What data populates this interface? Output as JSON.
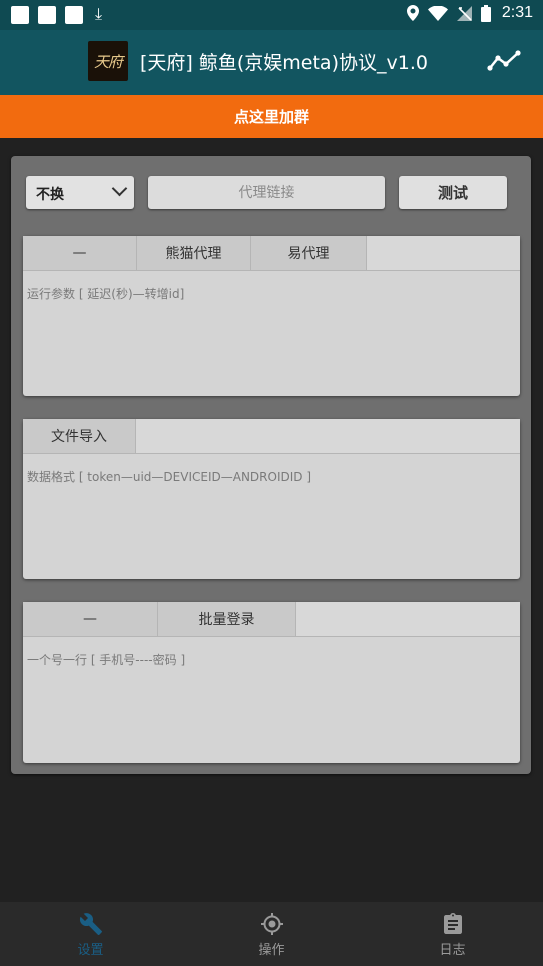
{
  "status_bar": {
    "time": "2:31",
    "icons": [
      "app-square-icon",
      "app-square-icon",
      "app-square-icon",
      "download-icon",
      "location-icon",
      "wifi-icon",
      "no-signal-icon",
      "battery-icon"
    ]
  },
  "app_bar": {
    "logo_text": "天府",
    "title": "[天府] 鲸鱼(京娱meta)协议_v1.0",
    "action_icon": "trend-icon"
  },
  "banner": {
    "text": "点这里加群"
  },
  "controls": {
    "mode_select": {
      "value": "不换"
    },
    "proxy_input": {
      "placeholder": "代理链接",
      "value": ""
    },
    "test_button": "测试"
  },
  "proxy_card": {
    "tabs": [
      "—",
      "熊猫代理",
      "易代理"
    ],
    "textarea_placeholder": "运行参数 [ 延迟(秒)—转增id]"
  },
  "import_card": {
    "tabs": [
      "文件导入"
    ],
    "textarea_placeholder": "数据格式 [ token—uid—DEVICEID—ANDROIDID ]"
  },
  "login_card": {
    "tabs": [
      "—",
      "批量登录"
    ],
    "textarea_placeholder": "一个号一行 [ 手机号----密码 ]"
  },
  "bottom_nav": [
    {
      "label": "设置",
      "icon": "wrench-icon",
      "active": true
    },
    {
      "label": "操作",
      "icon": "target-icon",
      "active": false
    },
    {
      "label": "日志",
      "icon": "clipboard-icon",
      "active": false
    }
  ],
  "colors": {
    "app_bar": "#125560",
    "status_bar": "#0f4a52",
    "banner": "#f26b0f",
    "active_nav": "#1a5e84"
  }
}
